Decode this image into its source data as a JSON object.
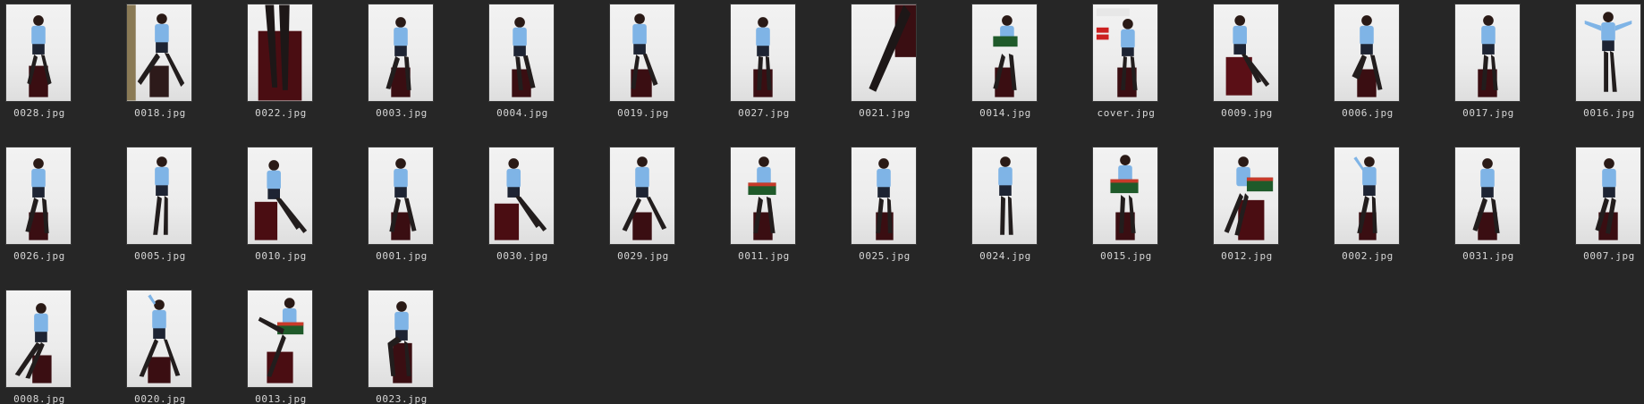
{
  "files": [
    {
      "name": "0028.jpg"
    },
    {
      "name": "0018.jpg"
    },
    {
      "name": "0022.jpg"
    },
    {
      "name": "0003.jpg"
    },
    {
      "name": "0004.jpg"
    },
    {
      "name": "0019.jpg"
    },
    {
      "name": "0027.jpg"
    },
    {
      "name": "0021.jpg"
    },
    {
      "name": "0014.jpg"
    },
    {
      "name": "cover.jpg"
    },
    {
      "name": "0009.jpg"
    },
    {
      "name": "0006.jpg"
    },
    {
      "name": "0017.jpg"
    },
    {
      "name": "0016.jpg"
    },
    {
      "name": "0026.jpg"
    },
    {
      "name": "0005.jpg"
    },
    {
      "name": "0010.jpg"
    },
    {
      "name": "0001.jpg"
    },
    {
      "name": "0030.jpg"
    },
    {
      "name": "0029.jpg"
    },
    {
      "name": "0011.jpg"
    },
    {
      "name": "0025.jpg"
    },
    {
      "name": "0024.jpg"
    },
    {
      "name": "0015.jpg"
    },
    {
      "name": "0012.jpg"
    },
    {
      "name": "0002.jpg"
    },
    {
      "name": "0031.jpg"
    },
    {
      "name": "0007.jpg"
    },
    {
      "name": "0008.jpg"
    },
    {
      "name": "0020.jpg"
    },
    {
      "name": "0013.jpg"
    },
    {
      "name": "0023.jpg"
    }
  ]
}
